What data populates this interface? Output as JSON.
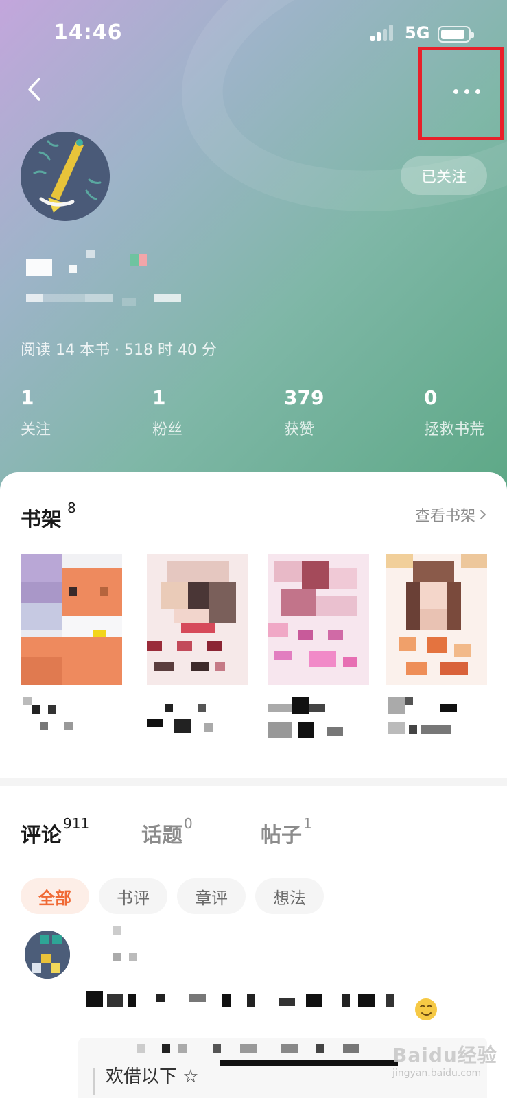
{
  "status_bar": {
    "time": "14:46",
    "network": "5G"
  },
  "header": {
    "back_icon": "chevron-left-icon",
    "more_icon": "more-horizontal-icon",
    "follow_label": "已关注",
    "reading_stats": "阅读 14 本书 · 518 时 40 分"
  },
  "stats": [
    {
      "value": "1",
      "label": "关注"
    },
    {
      "value": "1",
      "label": "粉丝"
    },
    {
      "value": "379",
      "label": "获赞"
    },
    {
      "value": "0",
      "label": "拯救书荒"
    }
  ],
  "bookshelf": {
    "title": "书架",
    "count": "8",
    "view_all": "查看书架"
  },
  "tabs": [
    {
      "label": "评论",
      "count": "911"
    },
    {
      "label": "话题",
      "count": "0"
    },
    {
      "label": "帖子",
      "count": "1"
    }
  ],
  "filters": [
    "全部",
    "书评",
    "章评",
    "想法"
  ],
  "comment": {
    "quote_text": "欢借以下 ☆"
  },
  "colors": {
    "accent": "#f06a35",
    "highlight_box": "#e8202a",
    "header_gradient_start": "#c3a6dc",
    "header_gradient_end": "#5da886"
  },
  "watermark": {
    "brand": "Baidu经验",
    "url": "jingyan.baidu.com"
  }
}
